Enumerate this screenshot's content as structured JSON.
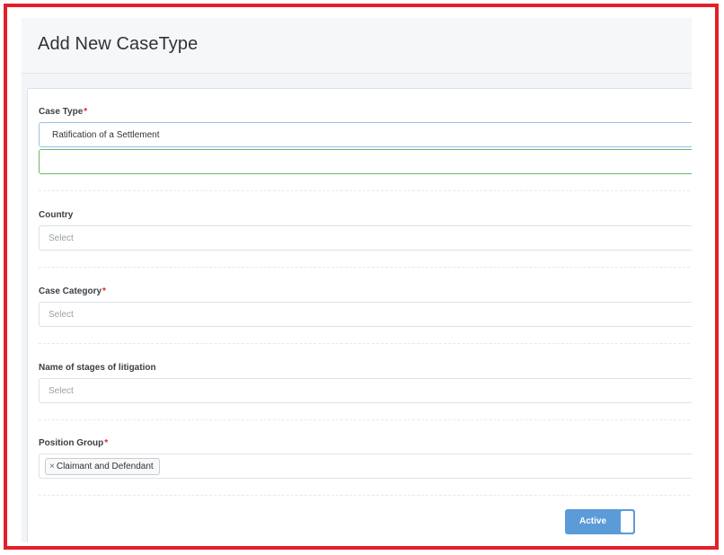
{
  "header": {
    "title": "Add New CaseType"
  },
  "form": {
    "case_type": {
      "label": "Case Type",
      "required_mark": "*",
      "value": "Ratification of a Settlement"
    },
    "country": {
      "label": "Country",
      "placeholder": "Select"
    },
    "case_category": {
      "label": "Case Category",
      "required_mark": "*",
      "placeholder": "Select"
    },
    "stages": {
      "label": "Name of stages of litigation",
      "placeholder": "Select"
    },
    "position_group": {
      "label": "Position Group",
      "required_mark": "*",
      "tags": [
        {
          "remove": "×",
          "label": "Claimant and Defendant"
        }
      ]
    },
    "status_toggle": {
      "label": "Active",
      "state": "on"
    }
  },
  "colors": {
    "frame": "#e3202a",
    "toggle": "#5b9bd8",
    "valid_border": "#66bb6a",
    "required": "#e3202a"
  }
}
